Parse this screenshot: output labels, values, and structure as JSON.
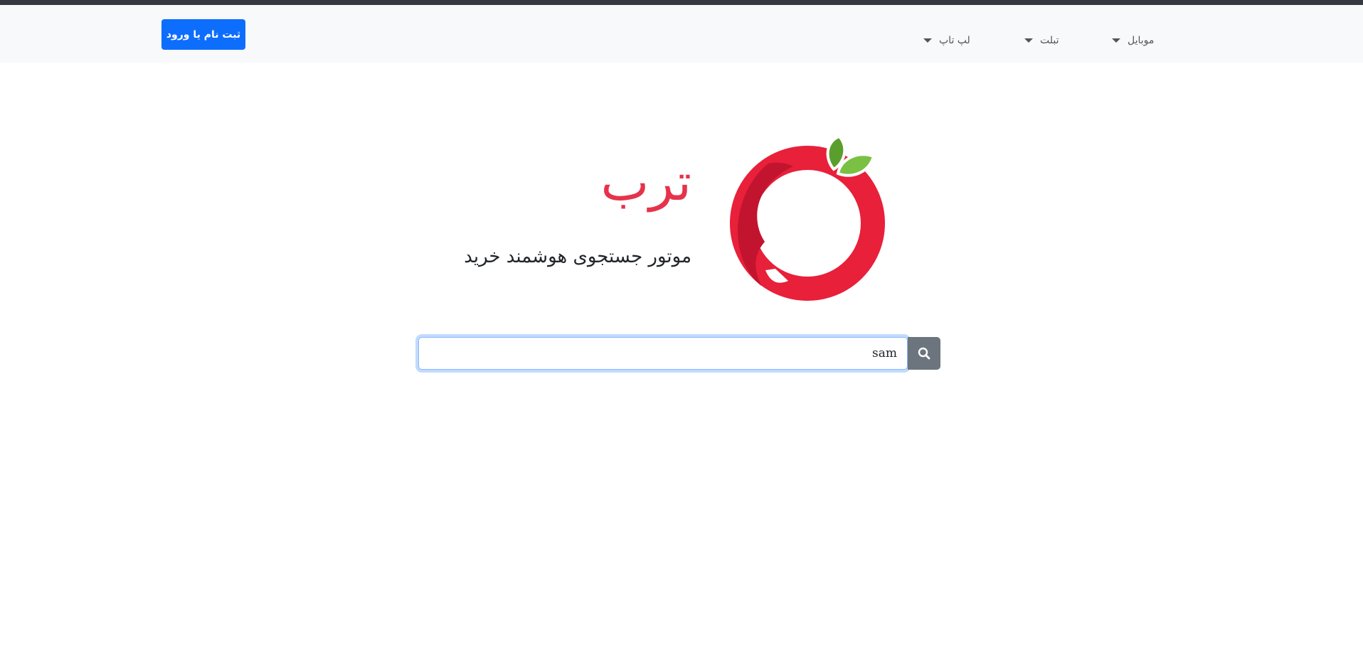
{
  "navbar": {
    "login_button": "ثبت نام یا ورود",
    "menu": [
      {
        "label": "موبایل"
      },
      {
        "label": "تبلت"
      },
      {
        "label": "لپ تاپ"
      }
    ]
  },
  "brand": {
    "name": "ترب",
    "tagline": "موتور جستجوی هوشمند خرید",
    "colors": {
      "primary": "#e5334b",
      "dark": "#c2142e",
      "leaf_dark": "#5a9e2c",
      "leaf_light": "#7ac143"
    }
  },
  "search": {
    "value": "sam",
    "icon": "search-icon"
  },
  "theme": {
    "accent": "#0d6efd",
    "navbar_bg": "#f8f9fa",
    "search_button_bg": "#6c757d"
  }
}
